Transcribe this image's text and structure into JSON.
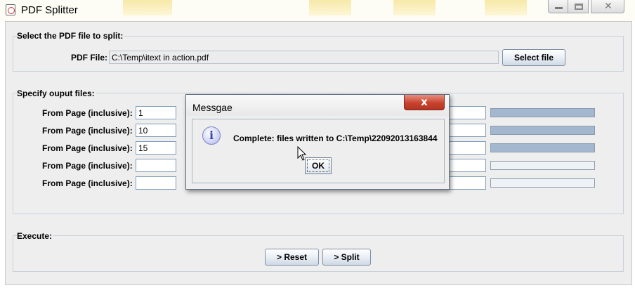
{
  "window": {
    "title": "PDF Splitter"
  },
  "select_group": {
    "legend": "Select the PDF file to split:",
    "pdf_label": "PDF File:",
    "pdf_value": "C:\\Temp\\itext in action.pdf",
    "select_button": "Select file"
  },
  "output_group": {
    "legend": "Specify ouput files:",
    "rows": [
      {
        "from_label": "From Page (inclusive):",
        "from_value": "1",
        "progress": 1.0
      },
      {
        "from_label": "From Page (inclusive):",
        "from_value": "10",
        "progress": 1.0
      },
      {
        "from_label": "From Page (inclusive):",
        "from_value": "15",
        "progress": 1.0
      },
      {
        "from_label": "From Page (inclusive):",
        "from_value": "",
        "progress": 0.0
      },
      {
        "from_label": "From Page (inclusive):",
        "from_value": "",
        "progress": 0.0
      }
    ]
  },
  "execute_group": {
    "legend": "Execute:",
    "reset_button": "> Reset",
    "split_button": "> Split"
  },
  "dialog": {
    "title": "Messgae",
    "close_glyph": "x",
    "icon": "info-icon",
    "message": "Complete: files written to C:\\Temp\\22092013163844",
    "ok_button": "OK"
  }
}
